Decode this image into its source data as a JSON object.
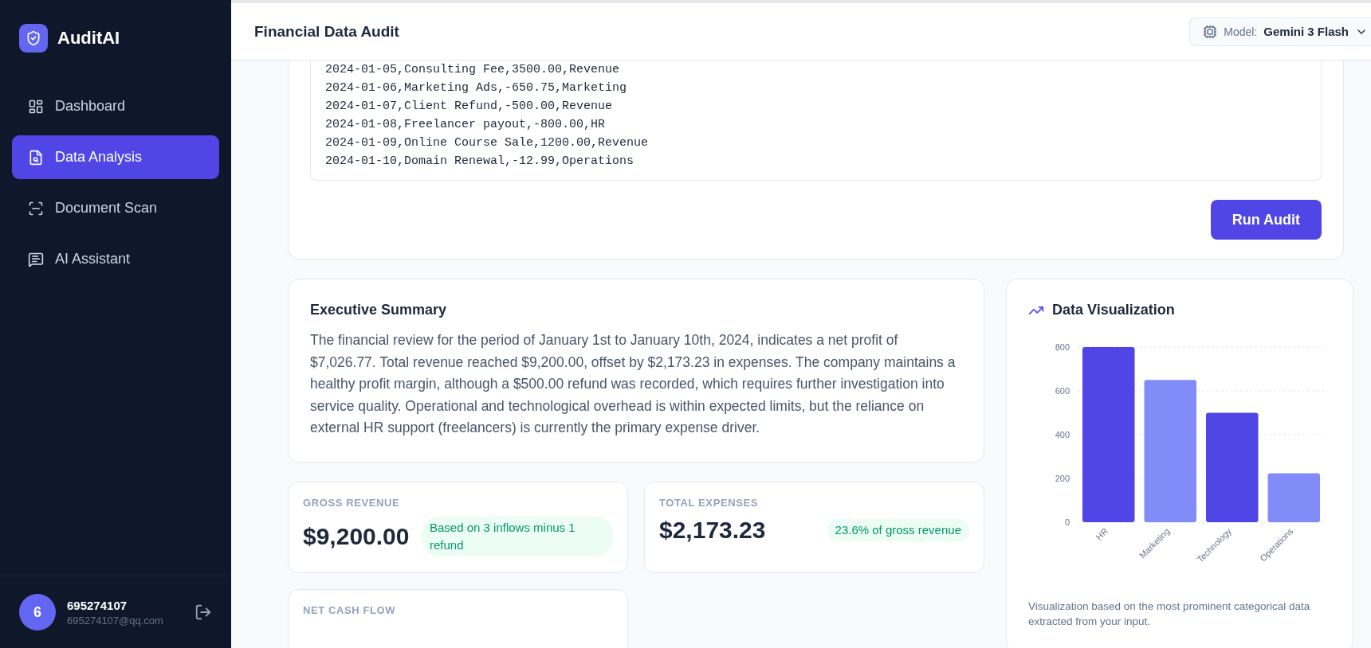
{
  "sidebar": {
    "brand": "AuditAI",
    "items": [
      {
        "label": "Dashboard",
        "kind": "dashboard",
        "selected": false
      },
      {
        "label": "Data Analysis",
        "kind": "analysis",
        "selected": true
      },
      {
        "label": "Document Scan",
        "kind": "scan",
        "selected": false
      },
      {
        "label": "AI Assistant",
        "kind": "assistant",
        "selected": false
      }
    ],
    "user": {
      "initial": "6",
      "name": "695274107",
      "email": "695274107@qq.com"
    }
  },
  "header": {
    "title": "Financial Data Audit",
    "model_label": "Model:",
    "model_value": "Gemini 3 Flash"
  },
  "input_card": {
    "lines": [
      "2024-01-05,Consulting Fee,3500.00,Revenue",
      "2024-01-06,Marketing Ads,-650.75,Marketing",
      "2024-01-07,Client Refund,-500.00,Revenue",
      "2024-01-08,Freelancer payout,-800.00,HR",
      "2024-01-09,Online Course Sale,1200.00,Revenue",
      "2024-01-10,Domain Renewal,-12.99,Operations"
    ],
    "button": "Run Audit"
  },
  "summary": {
    "title": "Executive Summary",
    "text": "The financial review for the period of January 1st to January 10th, 2024, indicates a net profit of $7,026.77. Total revenue reached $9,200.00, offset by $2,173.23 in expenses. The company maintains a healthy profit margin, although a $500.00 refund was recorded, which requires further investigation into service quality. Operational and technological overhead is within expected limits, but the reliance on external HR support (freelancers) is currently the primary expense driver."
  },
  "metrics": [
    {
      "label": "GROSS REVENUE",
      "value": "$9,200.00",
      "note": "Based on 3 inflows minus 1 refund"
    },
    {
      "label": "TOTAL EXPENSES",
      "value": "$2,173.23",
      "note": "23.6% of gross revenue"
    },
    {
      "label": "NET CASH FLOW"
    }
  ],
  "visualization": {
    "title": "Data Visualization",
    "caption": "Visualization based on the most prominent categorical data extracted from your input.",
    "chart_data": {
      "type": "bar",
      "categories": [
        "HR",
        "Marketing",
        "Technology",
        "Operations"
      ],
      "series": [
        {
          "colors": [
            "#4f46e5",
            "#818cf8",
            "#4f46e5",
            "#818cf8"
          ],
          "values": [
            800,
            650,
            500,
            224
          ]
        }
      ],
      "grid": true,
      "ylim": [
        0,
        800
      ],
      "yticks": [
        0,
        200,
        400,
        600,
        800
      ]
    }
  }
}
